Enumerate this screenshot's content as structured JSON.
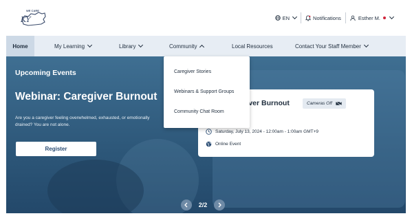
{
  "header": {
    "logo_top": "WE CARE",
    "logo_text": "KY",
    "language": "EN",
    "notifications": "Notifications",
    "user_name": "Esther M."
  },
  "nav": {
    "items": [
      {
        "label": "Home"
      },
      {
        "label": "My Learning"
      },
      {
        "label": "Library"
      },
      {
        "label": "Community"
      },
      {
        "label": "Local Resources"
      },
      {
        "label": "Contact Your Staff Member"
      }
    ]
  },
  "community_menu": {
    "items": [
      "Caregiver Stories",
      "Webinars & Support Groups",
      "Community Chat Room"
    ]
  },
  "hero": {
    "section_title": "Upcoming Events",
    "event_title": "Webinar: Caregiver Burnout",
    "description": "Are you a caregiver feeling overwhelmed, exhausted, or emotionally drained? You are not alone.",
    "register_label": "Register"
  },
  "event_card": {
    "title": "giver Burnout",
    "badge": "Cameras Off",
    "date": "Saturday, July 13, 2024 - 12:00am - 1:00am GMT+9",
    "location": "Online Event"
  },
  "pager": {
    "label": "2/2"
  },
  "colors": {
    "nav_bg": "#e7edf4",
    "hero_bg": "#2d5779",
    "accent_dot": "#d0243a",
    "pager_btn": "#6e8aa6"
  }
}
